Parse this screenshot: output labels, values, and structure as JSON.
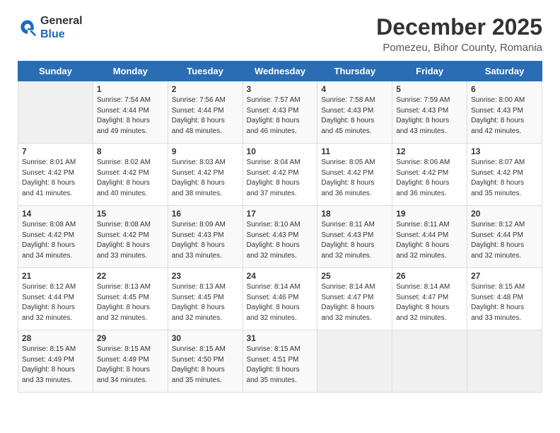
{
  "logo": {
    "general": "General",
    "blue": "Blue"
  },
  "title": "December 2025",
  "location": "Pomezeu, Bihor County, Romania",
  "days_header": [
    "Sunday",
    "Monday",
    "Tuesday",
    "Wednesday",
    "Thursday",
    "Friday",
    "Saturday"
  ],
  "weeks": [
    [
      {
        "day": "",
        "sunrise": "",
        "sunset": "",
        "daylight": ""
      },
      {
        "day": "1",
        "sunrise": "Sunrise: 7:54 AM",
        "sunset": "Sunset: 4:44 PM",
        "daylight": "Daylight: 8 hours and 49 minutes."
      },
      {
        "day": "2",
        "sunrise": "Sunrise: 7:56 AM",
        "sunset": "Sunset: 4:44 PM",
        "daylight": "Daylight: 8 hours and 48 minutes."
      },
      {
        "day": "3",
        "sunrise": "Sunrise: 7:57 AM",
        "sunset": "Sunset: 4:43 PM",
        "daylight": "Daylight: 8 hours and 46 minutes."
      },
      {
        "day": "4",
        "sunrise": "Sunrise: 7:58 AM",
        "sunset": "Sunset: 4:43 PM",
        "daylight": "Daylight: 8 hours and 45 minutes."
      },
      {
        "day": "5",
        "sunrise": "Sunrise: 7:59 AM",
        "sunset": "Sunset: 4:43 PM",
        "daylight": "Daylight: 8 hours and 43 minutes."
      },
      {
        "day": "6",
        "sunrise": "Sunrise: 8:00 AM",
        "sunset": "Sunset: 4:43 PM",
        "daylight": "Daylight: 8 hours and 42 minutes."
      }
    ],
    [
      {
        "day": "7",
        "sunrise": "Sunrise: 8:01 AM",
        "sunset": "Sunset: 4:42 PM",
        "daylight": "Daylight: 8 hours and 41 minutes."
      },
      {
        "day": "8",
        "sunrise": "Sunrise: 8:02 AM",
        "sunset": "Sunset: 4:42 PM",
        "daylight": "Daylight: 8 hours and 40 minutes."
      },
      {
        "day": "9",
        "sunrise": "Sunrise: 8:03 AM",
        "sunset": "Sunset: 4:42 PM",
        "daylight": "Daylight: 8 hours and 38 minutes."
      },
      {
        "day": "10",
        "sunrise": "Sunrise: 8:04 AM",
        "sunset": "Sunset: 4:42 PM",
        "daylight": "Daylight: 8 hours and 37 minutes."
      },
      {
        "day": "11",
        "sunrise": "Sunrise: 8:05 AM",
        "sunset": "Sunset: 4:42 PM",
        "daylight": "Daylight: 8 hours and 36 minutes."
      },
      {
        "day": "12",
        "sunrise": "Sunrise: 8:06 AM",
        "sunset": "Sunset: 4:42 PM",
        "daylight": "Daylight: 8 hours and 36 minutes."
      },
      {
        "day": "13",
        "sunrise": "Sunrise: 8:07 AM",
        "sunset": "Sunset: 4:42 PM",
        "daylight": "Daylight: 8 hours and 35 minutes."
      }
    ],
    [
      {
        "day": "14",
        "sunrise": "Sunrise: 8:08 AM",
        "sunset": "Sunset: 4:42 PM",
        "daylight": "Daylight: 8 hours and 34 minutes."
      },
      {
        "day": "15",
        "sunrise": "Sunrise: 8:08 AM",
        "sunset": "Sunset: 4:42 PM",
        "daylight": "Daylight: 8 hours and 33 minutes."
      },
      {
        "day": "16",
        "sunrise": "Sunrise: 8:09 AM",
        "sunset": "Sunset: 4:43 PM",
        "daylight": "Daylight: 8 hours and 33 minutes."
      },
      {
        "day": "17",
        "sunrise": "Sunrise: 8:10 AM",
        "sunset": "Sunset: 4:43 PM",
        "daylight": "Daylight: 8 hours and 32 minutes."
      },
      {
        "day": "18",
        "sunrise": "Sunrise: 8:11 AM",
        "sunset": "Sunset: 4:43 PM",
        "daylight": "Daylight: 8 hours and 32 minutes."
      },
      {
        "day": "19",
        "sunrise": "Sunrise: 8:11 AM",
        "sunset": "Sunset: 4:44 PM",
        "daylight": "Daylight: 8 hours and 32 minutes."
      },
      {
        "day": "20",
        "sunrise": "Sunrise: 8:12 AM",
        "sunset": "Sunset: 4:44 PM",
        "daylight": "Daylight: 8 hours and 32 minutes."
      }
    ],
    [
      {
        "day": "21",
        "sunrise": "Sunrise: 8:12 AM",
        "sunset": "Sunset: 4:44 PM",
        "daylight": "Daylight: 8 hours and 32 minutes."
      },
      {
        "day": "22",
        "sunrise": "Sunrise: 8:13 AM",
        "sunset": "Sunset: 4:45 PM",
        "daylight": "Daylight: 8 hours and 32 minutes."
      },
      {
        "day": "23",
        "sunrise": "Sunrise: 8:13 AM",
        "sunset": "Sunset: 4:45 PM",
        "daylight": "Daylight: 8 hours and 32 minutes."
      },
      {
        "day": "24",
        "sunrise": "Sunrise: 8:14 AM",
        "sunset": "Sunset: 4:46 PM",
        "daylight": "Daylight: 8 hours and 32 minutes."
      },
      {
        "day": "25",
        "sunrise": "Sunrise: 8:14 AM",
        "sunset": "Sunset: 4:47 PM",
        "daylight": "Daylight: 8 hours and 32 minutes."
      },
      {
        "day": "26",
        "sunrise": "Sunrise: 8:14 AM",
        "sunset": "Sunset: 4:47 PM",
        "daylight": "Daylight: 8 hours and 32 minutes."
      },
      {
        "day": "27",
        "sunrise": "Sunrise: 8:15 AM",
        "sunset": "Sunset: 4:48 PM",
        "daylight": "Daylight: 8 hours and 33 minutes."
      }
    ],
    [
      {
        "day": "28",
        "sunrise": "Sunrise: 8:15 AM",
        "sunset": "Sunset: 4:49 PM",
        "daylight": "Daylight: 8 hours and 33 minutes."
      },
      {
        "day": "29",
        "sunrise": "Sunrise: 8:15 AM",
        "sunset": "Sunset: 4:49 PM",
        "daylight": "Daylight: 8 hours and 34 minutes."
      },
      {
        "day": "30",
        "sunrise": "Sunrise: 8:15 AM",
        "sunset": "Sunset: 4:50 PM",
        "daylight": "Daylight: 8 hours and 35 minutes."
      },
      {
        "day": "31",
        "sunrise": "Sunrise: 8:15 AM",
        "sunset": "Sunset: 4:51 PM",
        "daylight": "Daylight: 8 hours and 35 minutes."
      },
      {
        "day": "",
        "sunrise": "",
        "sunset": "",
        "daylight": ""
      },
      {
        "day": "",
        "sunrise": "",
        "sunset": "",
        "daylight": ""
      },
      {
        "day": "",
        "sunrise": "",
        "sunset": "",
        "daylight": ""
      }
    ]
  ]
}
